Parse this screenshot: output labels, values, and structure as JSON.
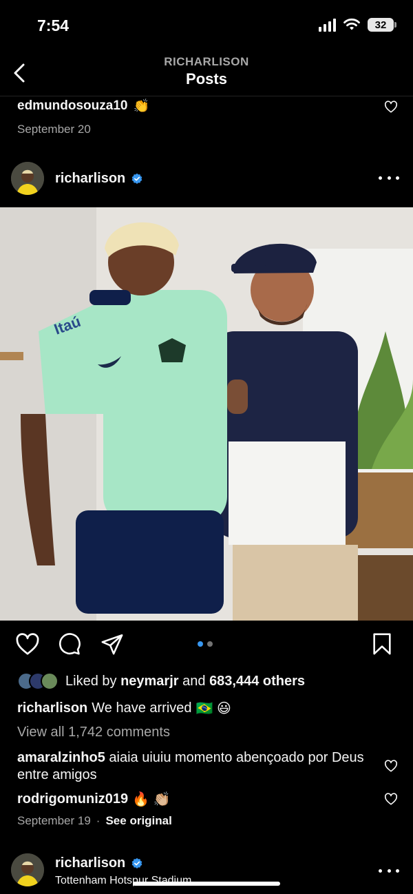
{
  "status_bar": {
    "time": "7:54",
    "battery": "32"
  },
  "header": {
    "account": "RICHARLISON",
    "title": "Posts"
  },
  "prev_post": {
    "commenter": "edmundosouza10",
    "comment_emoji": "👏",
    "date": "September 20"
  },
  "post": {
    "username": "richarlison",
    "photo_alt": "Two men embracing, one in a mint green Brasil jersey, one in a navy cap and jacket",
    "carousel": {
      "count": 2,
      "active": 0,
      "active_color": "#3897f0",
      "inactive_color": "#737373"
    },
    "likes": {
      "prefix": "Liked by",
      "user": "neymarjr",
      "middle": "and",
      "count": "683,444 others"
    },
    "caption": {
      "user": "richarlison",
      "text": "We have arrived",
      "emojis": "🇧🇷 😃"
    },
    "view_all": "View all 1,742 comments",
    "comments": [
      {
        "user": "amaralzinho5",
        "text": "aiaia uiuiu momento abençoado por Deus entre amigos"
      },
      {
        "user": "rodrigomuniz019",
        "text": "🔥 👏🏼"
      }
    ],
    "date": "September 19",
    "separator": "·",
    "see_original": "See original"
  },
  "next_post": {
    "username": "richarlison",
    "location": "Tottenham Hotspur Stadium"
  },
  "icons": [
    "back-icon",
    "heart-icon",
    "comment-icon",
    "share-icon",
    "bookmark-icon",
    "more-icon",
    "verified-icon"
  ],
  "colors": {
    "background": "#000000",
    "verified": "#3897f0",
    "muted": "#a8a8a8"
  }
}
